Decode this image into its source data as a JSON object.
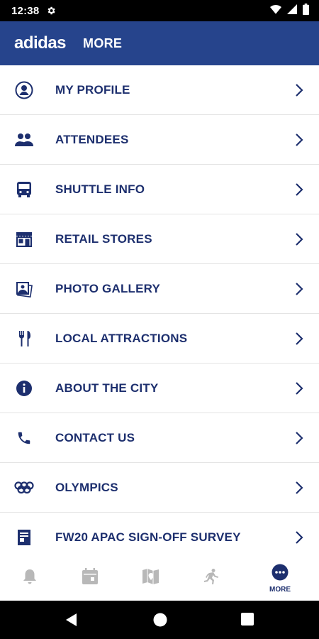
{
  "status_bar": {
    "time": "12:38",
    "icons": [
      "gear-icon",
      "wifi-icon",
      "signal-icon",
      "battery-icon"
    ]
  },
  "header": {
    "brand": "adidas",
    "title": "MORE"
  },
  "colors": {
    "header_bg": "#26448c",
    "accent": "#1d2f6e",
    "inactive_icon": "#b8b8b8"
  },
  "menu": {
    "items": [
      {
        "label": "MY PROFILE",
        "icon": "profile-icon"
      },
      {
        "label": "ATTENDEES",
        "icon": "attendees-icon"
      },
      {
        "label": "SHUTTLE INFO",
        "icon": "bus-icon"
      },
      {
        "label": "RETAIL STORES",
        "icon": "store-icon"
      },
      {
        "label": "PHOTO GALLERY",
        "icon": "photo-gallery-icon"
      },
      {
        "label": "LOCAL ATTRACTIONS",
        "icon": "fork-knife-icon"
      },
      {
        "label": "ABOUT THE CITY",
        "icon": "info-icon"
      },
      {
        "label": "CONTACT US",
        "icon": "phone-icon"
      },
      {
        "label": "OLYMPICS",
        "icon": "olympic-rings-icon"
      },
      {
        "label": "FW20 APAC SIGN-OFF SURVEY",
        "icon": "survey-icon"
      }
    ]
  },
  "bottom_nav": {
    "tabs": [
      {
        "icon": "bell-icon",
        "label": ""
      },
      {
        "icon": "calendar-icon",
        "label": ""
      },
      {
        "icon": "map-icon",
        "label": ""
      },
      {
        "icon": "runner-icon",
        "label": ""
      },
      {
        "icon": "more-icon",
        "label": "MORE",
        "active": true
      }
    ]
  },
  "system_nav": {
    "buttons": [
      "back-icon",
      "home-icon",
      "recents-icon"
    ]
  }
}
